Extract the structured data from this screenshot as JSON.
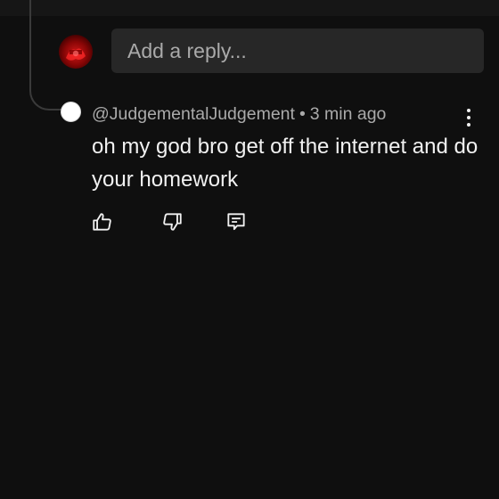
{
  "reply_box": {
    "placeholder": "Add a reply..."
  },
  "comment": {
    "author": "@JudgementalJudgement",
    "separator": "•",
    "time": "3 min ago",
    "text": "oh my god bro get off the internet and do your homework"
  },
  "icons": {
    "like": "thumbs-up-icon",
    "dislike": "thumbs-down-icon",
    "reply": "reply-icon",
    "more": "more-vertical-icon"
  },
  "colors": {
    "background": "#0f0f0f",
    "input_background": "#272727",
    "primary_text": "#f1f1f1",
    "secondary_text": "#aaaaaa",
    "self_avatar": "#b30c0c"
  }
}
